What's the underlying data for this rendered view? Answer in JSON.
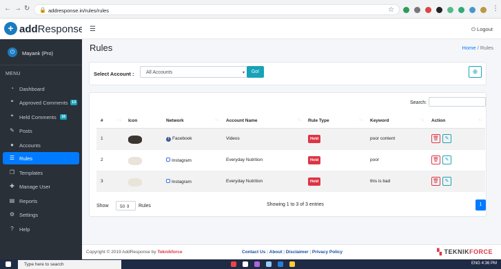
{
  "browser": {
    "url": "addresponse.in/rules/rules"
  },
  "header": {
    "brand_prefix": "add",
    "brand_suffix": "Response",
    "logout_label": "Logout"
  },
  "sidebar": {
    "user_name": "Mayank (Pro)",
    "menu_heading": "MENU",
    "items": [
      {
        "label": "Dashboard",
        "icon": "dashboard-icon"
      },
      {
        "label": "Approved Comments",
        "icon": "comments-icon",
        "badge": "13"
      },
      {
        "label": "Held Comments",
        "icon": "comments-icon",
        "badge": "16"
      },
      {
        "label": "Posts",
        "icon": "edit-icon"
      },
      {
        "label": "Accounts",
        "icon": "user-icon"
      },
      {
        "label": "Rules",
        "icon": "list-icon",
        "active": true
      },
      {
        "label": "Templates",
        "icon": "copy-icon"
      },
      {
        "label": "Manage User",
        "icon": "user-plus-icon"
      },
      {
        "label": "Reports",
        "icon": "chart-icon"
      },
      {
        "label": "Settings",
        "icon": "gear-icon"
      },
      {
        "label": "Help",
        "icon": "help-icon"
      }
    ]
  },
  "page": {
    "title": "Rules",
    "breadcrumb_home": "Home",
    "breadcrumb_current": "Rules"
  },
  "filter": {
    "label": "Select Account :",
    "selected": "All Accounts",
    "go_label": "Go!"
  },
  "table": {
    "search_label": "Search:",
    "columns": [
      "#",
      "Icon",
      "Network",
      "Account Name",
      "Rule Type",
      "Keyword",
      "Action"
    ],
    "rows": [
      {
        "num": "1",
        "network": "Facebook",
        "account": "Videos",
        "rule_type": "Hold",
        "keyword": "poor content"
      },
      {
        "num": "2",
        "network": "Instagram",
        "account": "Everyday Nutrition",
        "rule_type": "Hold",
        "keyword": "poor"
      },
      {
        "num": "3",
        "network": "Instagram",
        "account": "Everyday Nutrition",
        "rule_type": "Hold",
        "keyword": "this is bad"
      }
    ],
    "show_label": "Show",
    "page_size": "50",
    "page_size_suffix": "Rules",
    "info": "Showing 1 to 3 of 3 entries",
    "current_page": "1"
  },
  "footer": {
    "copyright": "Copyright © 2019 AddResponse by",
    "copyright_brand": "Teknikforce",
    "links": [
      "Contact Us",
      "About",
      "Disclaimer",
      "Privacy Policy"
    ],
    "logo_prefix": "TEKNIK",
    "logo_suffix": "FORCE"
  },
  "taskbar": {
    "search_placeholder": "Type here to search",
    "lang": "ENG",
    "time": "4:36 PM"
  }
}
